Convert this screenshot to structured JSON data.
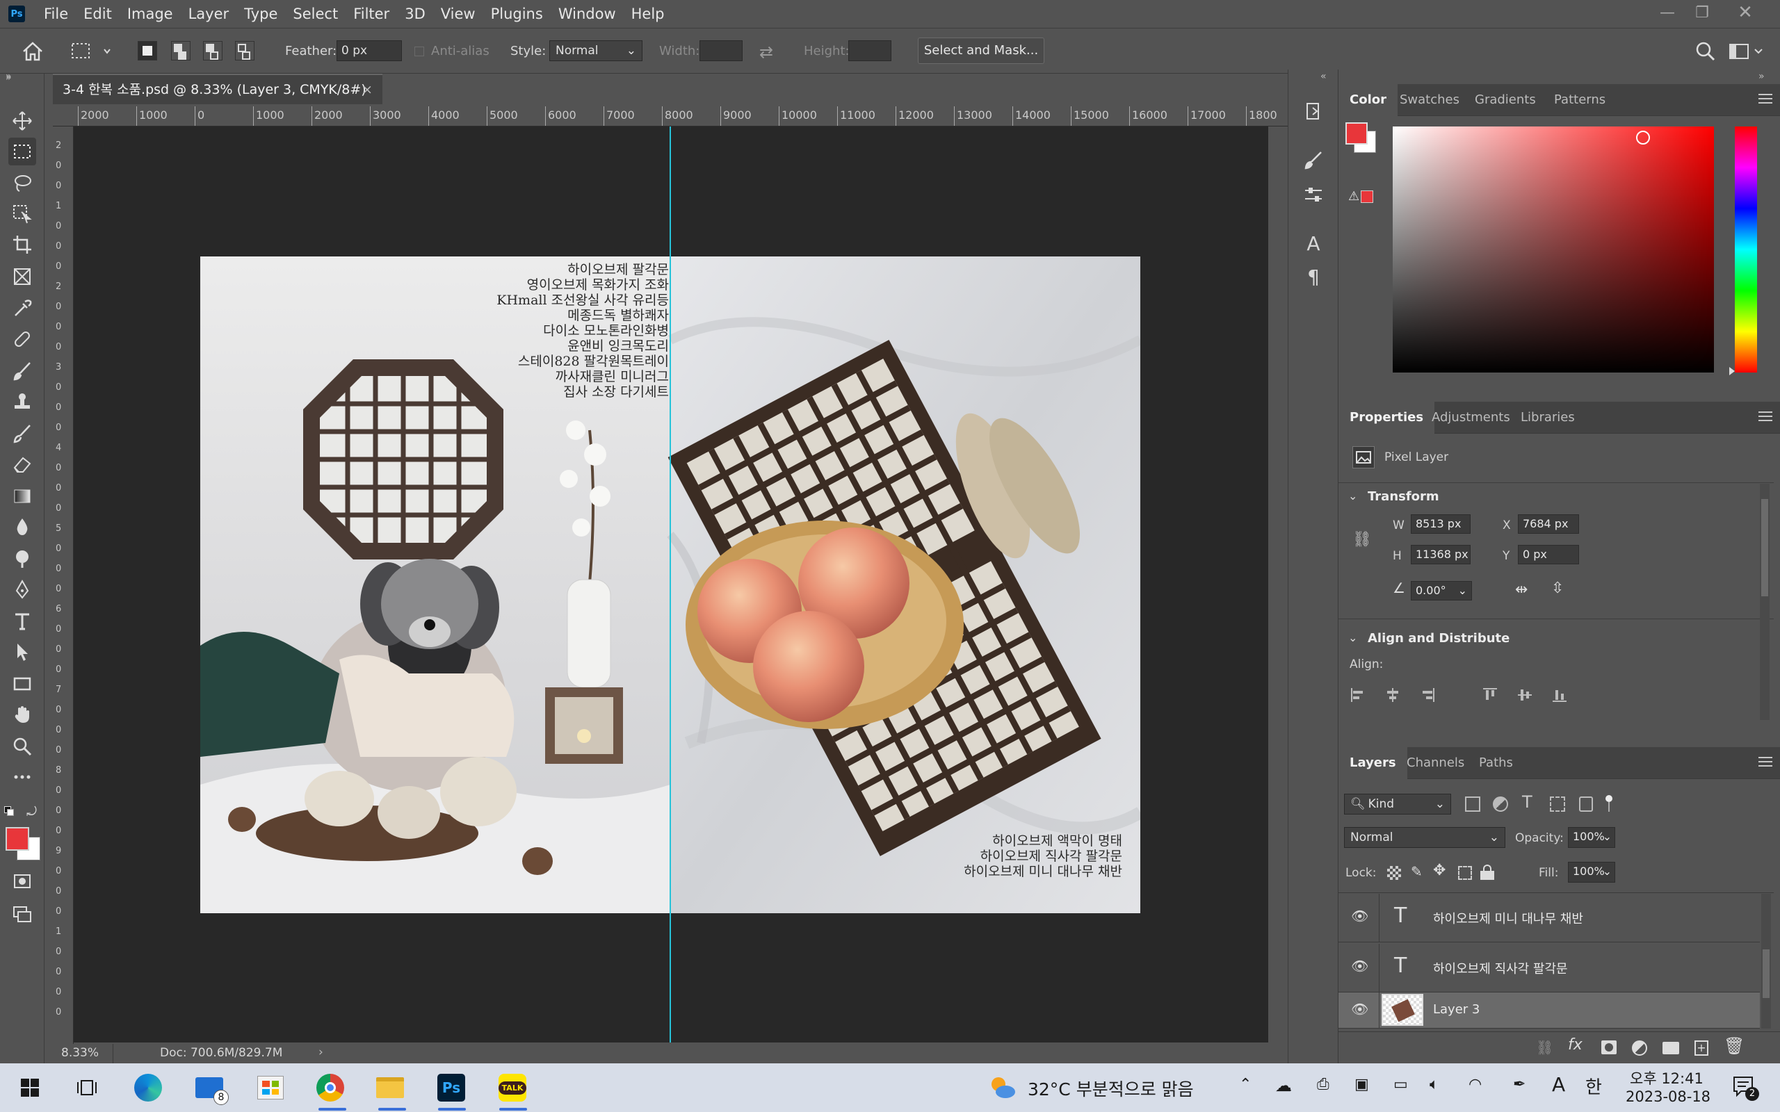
{
  "app": {
    "menus": [
      "File",
      "Edit",
      "Image",
      "Layer",
      "Type",
      "Select",
      "Filter",
      "3D",
      "View",
      "Plugins",
      "Window",
      "Help"
    ],
    "logo_text": "Ps"
  },
  "options_bar": {
    "feather_label": "Feather:",
    "feather_value": "0 px",
    "anti_alias_label": "Anti-alias",
    "style_label": "Style:",
    "style_value": "Normal",
    "width_label": "Width:",
    "height_label": "Height:",
    "select_mask_label": "Select and Mask..."
  },
  "document": {
    "tab_title": "3-4 한복 소품.psd @ 8.33% (Layer 3, CMYK/8#)",
    "close_glyph": "×",
    "zoom": "8.33%",
    "doc_info": "Doc: 700.6M/829.7M",
    "ruler_h_labels": [
      "2000",
      "1000",
      "0",
      "1000",
      "2000",
      "3000",
      "4000",
      "5000",
      "6000",
      "7000",
      "8000",
      "9000",
      "10000",
      "11000",
      "12000",
      "13000",
      "14000",
      "15000",
      "16000",
      "17000",
      "1800"
    ],
    "ruler_v_labels": [
      "2",
      "0",
      "0",
      "1",
      "0",
      "0",
      "0",
      "2",
      "0",
      "0",
      "0",
      "3",
      "0",
      "0",
      "0",
      "4",
      "0",
      "0",
      "0",
      "5",
      "0",
      "0",
      "0",
      "6",
      "0",
      "0",
      "0",
      "7",
      "0",
      "0",
      "0",
      "8",
      "0",
      "0",
      "0",
      "9",
      "0",
      "0",
      "0",
      "1",
      "0",
      "0",
      "0",
      "0"
    ]
  },
  "artwork": {
    "left_text": [
      "하이오브제 팔각문",
      "영이오브제 목화가지 조화",
      "KHmall 조선왕실 사각 유리등",
      "메종드독 별하쾌자",
      "다이소 모노톤라인화병",
      "윤앤비 잉크목도리",
      "스테이828 팔각원목트레이",
      "까사재클린 미니러그",
      "집사 소장 다기세트"
    ],
    "right_text": [
      "하이오브제 액막이 명태",
      "하이오브제 직사각 팔각문",
      "하이오브제 미니 대나무 채반"
    ]
  },
  "color_panel": {
    "tabs": [
      "Color",
      "Swatches",
      "Gradients",
      "Patterns"
    ],
    "fg_color": "#e8363a",
    "bg_color": "#ffffff",
    "hue_color": "#ff0000"
  },
  "properties_panel": {
    "tabs": [
      "Properties",
      "Adjustments",
      "Libraries"
    ],
    "layer_type": "Pixel Layer",
    "transform_title": "Transform",
    "w_label": "W",
    "w_value": "8513 px",
    "h_label": "H",
    "h_value": "11368 px",
    "x_label": "X",
    "x_value": "7684 px",
    "y_label": "Y",
    "y_value": "0 px",
    "angle_value": "0.00°",
    "align_title": "Align and Distribute",
    "align_label": "Align:"
  },
  "layers_panel": {
    "tabs": [
      "Layers",
      "Channels",
      "Paths"
    ],
    "filter_kind": "Kind",
    "blend_mode": "Normal",
    "opacity_label": "Opacity:",
    "opacity_value": "100%",
    "lock_label": "Lock:",
    "fill_label": "Fill:",
    "fill_value": "100%",
    "layers": [
      {
        "name": "하이오브제 미니 대나무 채반",
        "type": "text"
      },
      {
        "name": "하이오브제 직사각 팔각문",
        "type": "text"
      },
      {
        "name": "Layer 3",
        "type": "pixel"
      }
    ]
  },
  "taskbar": {
    "mail_badge": "8",
    "weather": "32°C  부분적으로 맑음",
    "ime_a": "A",
    "ime_han": "한",
    "time_period": "오후 12:41",
    "date": "2023-08-18",
    "notif_count": "2"
  }
}
